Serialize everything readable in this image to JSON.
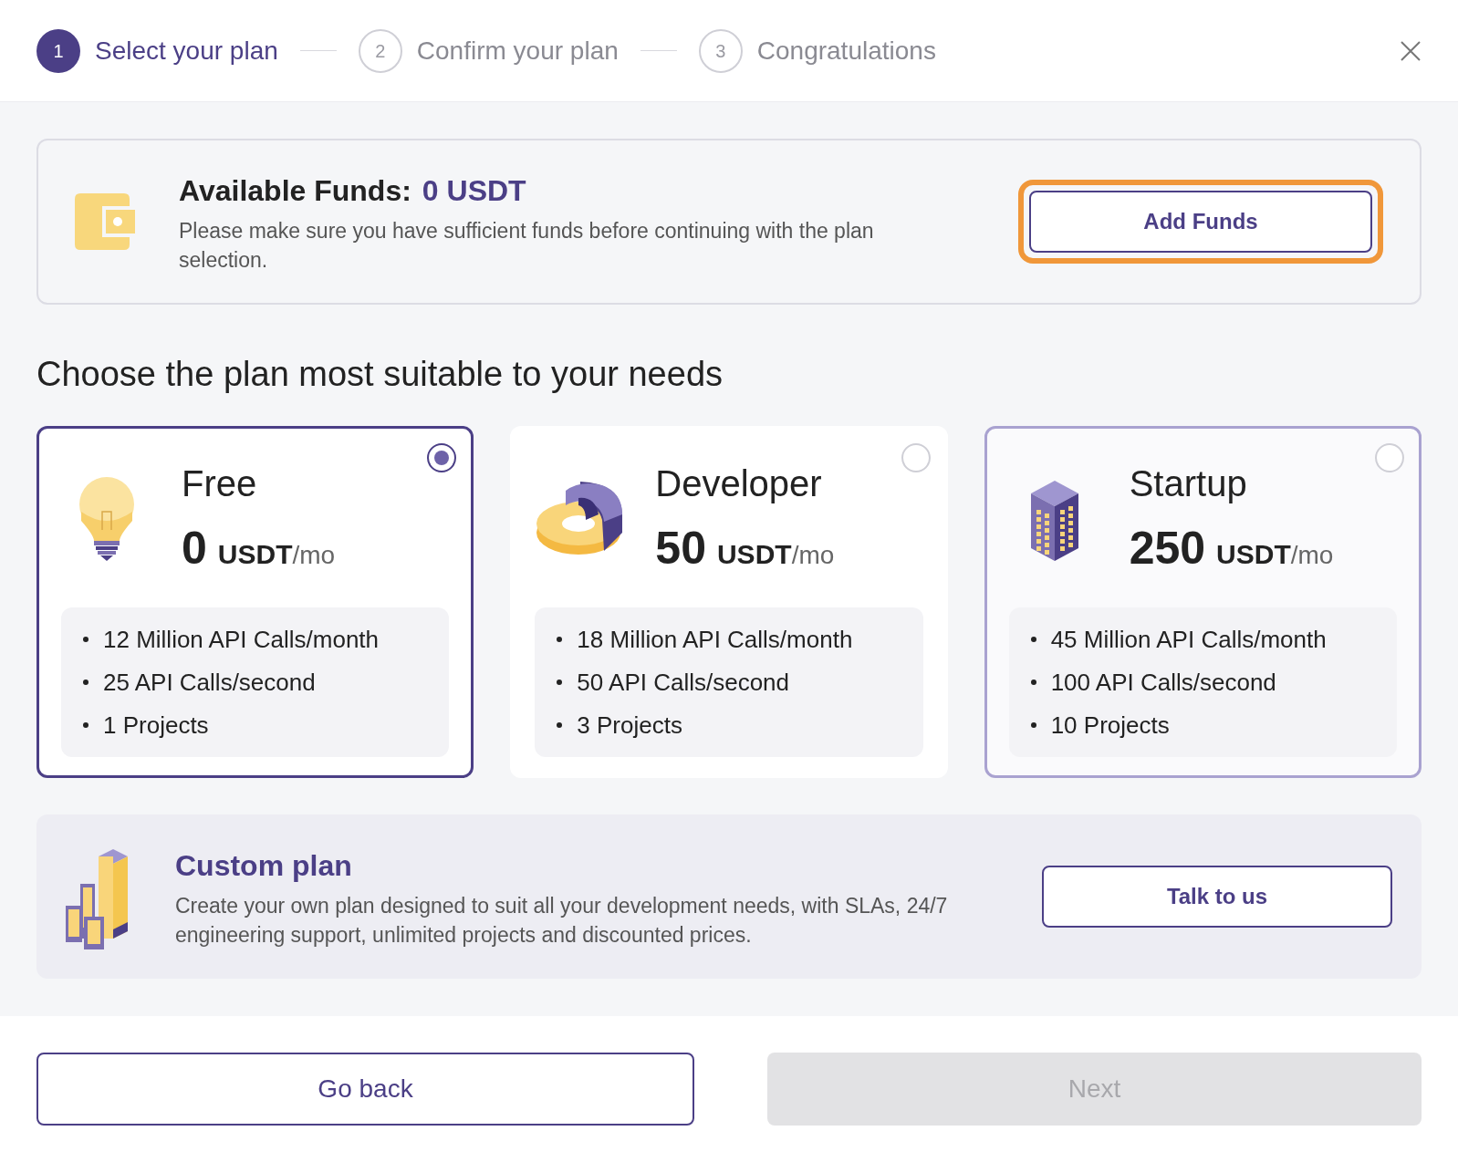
{
  "steps": [
    {
      "number": "1",
      "label": "Select your plan",
      "selected": true
    },
    {
      "number": "2",
      "label": "Confirm your plan",
      "selected": false
    },
    {
      "number": "3",
      "label": "Congratulations",
      "selected": false
    }
  ],
  "funds": {
    "label": "Available Funds:",
    "amount": "0 USDT",
    "note": "Please make sure you have sufficient funds before continuing with the plan selection.",
    "button": "Add Funds",
    "button_focused": true
  },
  "heading": "Choose the plan most suitable to your needs",
  "plans": [
    {
      "kind": "bulb",
      "name": "Free",
      "price": "0",
      "currency": "USDT",
      "period": "/mo",
      "selected": true,
      "hovered": false,
      "features": [
        "12 Million API Calls/month",
        "25 API Calls/second",
        "1 Projects"
      ]
    },
    {
      "kind": "donut",
      "name": "Developer",
      "price": "50",
      "currency": "USDT",
      "period": "/mo",
      "selected": false,
      "hovered": false,
      "features": [
        "18 Million API Calls/month",
        "50 API Calls/second",
        "3 Projects"
      ]
    },
    {
      "kind": "building",
      "name": "Startup",
      "price": "250",
      "currency": "USDT",
      "period": "/mo",
      "selected": false,
      "hovered": true,
      "features": [
        "45 Million API Calls/month",
        "100 API Calls/second",
        "10 Projects"
      ]
    }
  ],
  "custom": {
    "title": "Custom plan",
    "text": "Create your own plan designed to suit all your development needs, with SLAs, 24/7 engineering support, unlimited projects and discounted prices.",
    "button": "Talk to us"
  },
  "footer": {
    "back": "Go back",
    "next": "Next",
    "next_disabled": true
  }
}
